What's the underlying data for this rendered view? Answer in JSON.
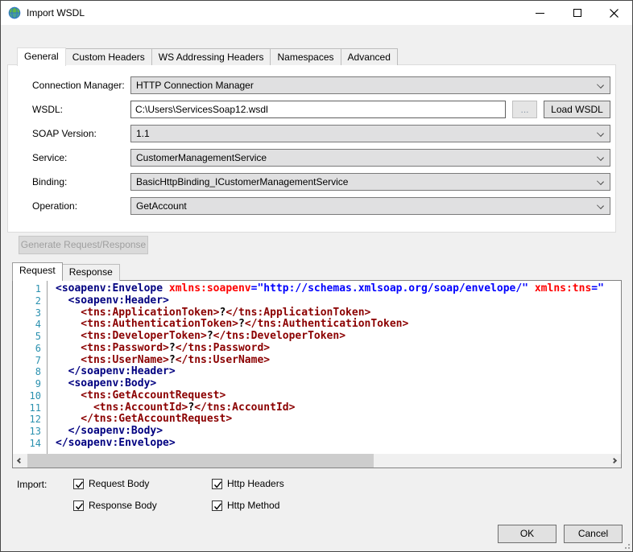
{
  "window": {
    "title": "Import WSDL"
  },
  "tabs": [
    "General",
    "Custom Headers",
    "WS Addressing Headers",
    "Namespaces",
    "Advanced"
  ],
  "active_tab": "General",
  "form": {
    "connection_manager": {
      "label": "Connection Manager:",
      "value": "HTTP Connection Manager"
    },
    "wsdl": {
      "label": "WSDL:",
      "value": "C:\\Users\\ServicesSoap12.wsdl",
      "browse_label": "...",
      "load_label": "Load WSDL"
    },
    "soap_version": {
      "label": "SOAP Version:",
      "value": "1.1"
    },
    "service": {
      "label": "Service:",
      "value": "CustomerManagementService"
    },
    "binding": {
      "label": "Binding:",
      "value": "BasicHttpBinding_ICustomerManagementService"
    },
    "operation": {
      "label": "Operation:",
      "value": "GetAccount"
    }
  },
  "generate_button_label": "Generate Request/Response",
  "editor_tabs": [
    "Request",
    "Response"
  ],
  "editor": {
    "active_tab": "Request",
    "lines": [
      {
        "n": 1,
        "tokens": [
          [
            "n",
            "<soapenv:Envelope"
          ],
          [
            "x",
            " "
          ],
          [
            "a",
            "xmlns:soapenv"
          ],
          [
            "s",
            "=\"http://schemas.xmlsoap.org/soap/envelope/\""
          ],
          [
            "x",
            " "
          ],
          [
            "a",
            "xmlns:tns"
          ],
          [
            "s",
            "=\""
          ]
        ]
      },
      {
        "n": 2,
        "tokens": [
          [
            "n",
            "  <soapenv:Header>"
          ]
        ]
      },
      {
        "n": 3,
        "tokens": [
          [
            "t",
            "    <tns:ApplicationToken>"
          ],
          [
            "x",
            "?"
          ],
          [
            "t",
            "</tns:ApplicationToken>"
          ]
        ]
      },
      {
        "n": 4,
        "tokens": [
          [
            "t",
            "    <tns:AuthenticationToken>"
          ],
          [
            "x",
            "?"
          ],
          [
            "t",
            "</tns:AuthenticationToken>"
          ]
        ]
      },
      {
        "n": 5,
        "tokens": [
          [
            "t",
            "    <tns:DeveloperToken>"
          ],
          [
            "x",
            "?"
          ],
          [
            "t",
            "</tns:DeveloperToken>"
          ]
        ]
      },
      {
        "n": 6,
        "tokens": [
          [
            "t",
            "    <tns:Password>"
          ],
          [
            "x",
            "?"
          ],
          [
            "t",
            "</tns:Password>"
          ]
        ]
      },
      {
        "n": 7,
        "tokens": [
          [
            "t",
            "    <tns:UserName>"
          ],
          [
            "x",
            "?"
          ],
          [
            "t",
            "</tns:UserName>"
          ]
        ]
      },
      {
        "n": 8,
        "tokens": [
          [
            "n",
            "  </soapenv:Header>"
          ]
        ]
      },
      {
        "n": 9,
        "tokens": [
          [
            "n",
            "  <soapenv:Body>"
          ]
        ]
      },
      {
        "n": 10,
        "tokens": [
          [
            "t",
            "    <tns:GetAccountRequest>"
          ]
        ]
      },
      {
        "n": 11,
        "tokens": [
          [
            "t",
            "      <tns:AccountId>"
          ],
          [
            "x",
            "?"
          ],
          [
            "t",
            "</tns:AccountId>"
          ]
        ]
      },
      {
        "n": 12,
        "tokens": [
          [
            "t",
            "    </tns:GetAccountRequest>"
          ]
        ]
      },
      {
        "n": 13,
        "tokens": [
          [
            "n",
            "  </soapenv:Body>"
          ]
        ]
      },
      {
        "n": 14,
        "tokens": [
          [
            "n",
            "</soapenv:Envelope>"
          ]
        ]
      }
    ]
  },
  "import": {
    "label": "Import:",
    "checkboxes": [
      {
        "label": "Request Body",
        "checked": true
      },
      {
        "label": "Response Body",
        "checked": true
      },
      {
        "label": "Http Headers",
        "checked": true
      },
      {
        "label": "Http Method",
        "checked": true
      }
    ]
  },
  "footer": {
    "ok_label": "OK",
    "cancel_label": "Cancel"
  },
  "colors": {
    "titlebar_bg": "#ffffff",
    "dialog_bg": "#f0f0f0",
    "tag_soapenv": "#000080",
    "tag_tns": "#8B0000",
    "attr_name": "#FF0000",
    "attr_value": "#0000FF",
    "line_number": "#2B91AF",
    "combo_bg": "#e0e0e1"
  }
}
